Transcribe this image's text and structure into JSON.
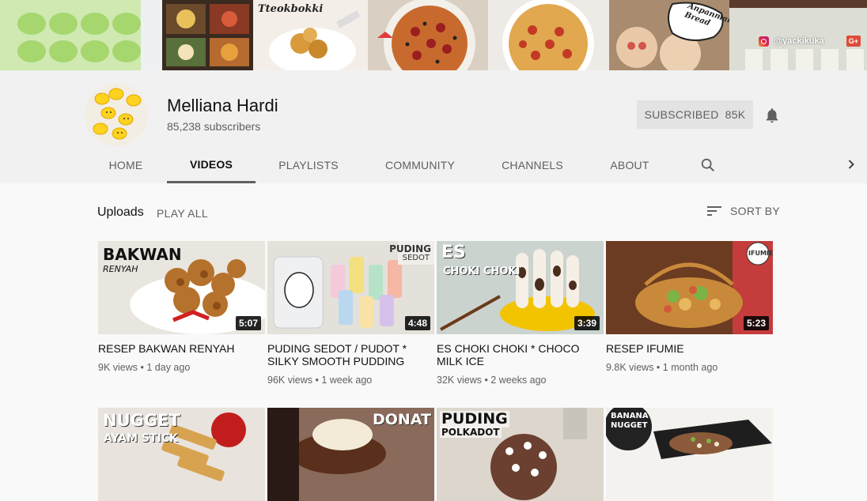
{
  "banner": {
    "tile_texts": [
      "Tteokbokki",
      "Anpanman Bread"
    ],
    "social_handle": "@yackikuka",
    "gplus_label": "G+"
  },
  "channel": {
    "name": "Melliana Hardi",
    "subscribers": "85,238 subscribers",
    "subscribe_label": "SUBSCRIBED",
    "subscribe_count": "85K"
  },
  "tabs": [
    {
      "label": "HOME"
    },
    {
      "label": "VIDEOS"
    },
    {
      "label": "PLAYLISTS"
    },
    {
      "label": "COMMUNITY"
    },
    {
      "label": "CHANNELS"
    },
    {
      "label": "ABOUT"
    }
  ],
  "section": {
    "title": "Uploads",
    "play_all": "PLAY ALL",
    "sort_by": "SORT BY"
  },
  "videos": [
    {
      "title": "RESEP BAKWAN RENYAH",
      "views": "9K views",
      "age": "1 day ago",
      "duration": "5:07",
      "thumb_text": "BAKWAN",
      "thumb_sub": "RENYAH"
    },
    {
      "title": "PUDING SEDOT / PUDOT * SILKY SMOOTH PUDDING",
      "views": "96K views",
      "age": "1 week ago",
      "duration": "4:48",
      "thumb_text": "PUDING",
      "thumb_sub": "SEDOT"
    },
    {
      "title": "ES CHOKI CHOKI * CHOCO MILK ICE",
      "views": "32K views",
      "age": "2 weeks ago",
      "duration": "3:39",
      "thumb_text": "ES",
      "thumb_sub": "CHOKI CHOKI"
    },
    {
      "title": "RESEP IFUMIE",
      "views": "9.8K views",
      "age": "1 month ago",
      "duration": "5:23",
      "thumb_text": "IFUMIE",
      "thumb_sub": ""
    },
    {
      "thumb_text": "NUGGET",
      "thumb_sub": "AYAM STICK"
    },
    {
      "thumb_text": "DONAT",
      "thumb_sub": ""
    },
    {
      "thumb_text": "PUDING",
      "thumb_sub": "POLKADOT"
    },
    {
      "thumb_text": "BANANA",
      "thumb_sub": "NUGGET"
    }
  ],
  "colors": {
    "header_bg": "#f1f1f1",
    "text_primary": "#111111",
    "text_secondary": "#606060",
    "subscribed_bg": "#e3e3e3"
  }
}
